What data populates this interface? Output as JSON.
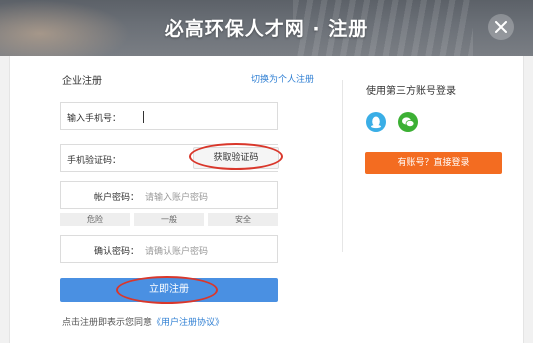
{
  "header": {
    "title": "必高环保人才网 · 注册"
  },
  "form": {
    "title": "企业注册",
    "switch_link": "切换为个人注册",
    "phone": {
      "label": "输入手机号：",
      "value": ""
    },
    "sms": {
      "label": "手机验证码：",
      "value": "",
      "button": "获取验证码"
    },
    "password": {
      "label": "帐户密码：",
      "placeholder": "请输入账户密码"
    },
    "strength": [
      "危险",
      "一般",
      "安全"
    ],
    "confirm": {
      "label": "确认密码：",
      "placeholder": "请确认账户密码"
    },
    "submit": "立即注册",
    "agreement_text": "点击注册即表示您同意",
    "agreement_link": "《用户注册协议》"
  },
  "third_party": {
    "title": "使用第三方账号登录",
    "icons": [
      "qq-icon",
      "wechat-icon"
    ],
    "login_button": "有账号？直接登录"
  },
  "colors": {
    "primary_blue": "#4a90e2",
    "link_blue": "#2f7fd3",
    "orange": "#f36c21",
    "qq": "#3aaee6",
    "wechat": "#3cb034",
    "annotation_red": "#d9372b"
  }
}
